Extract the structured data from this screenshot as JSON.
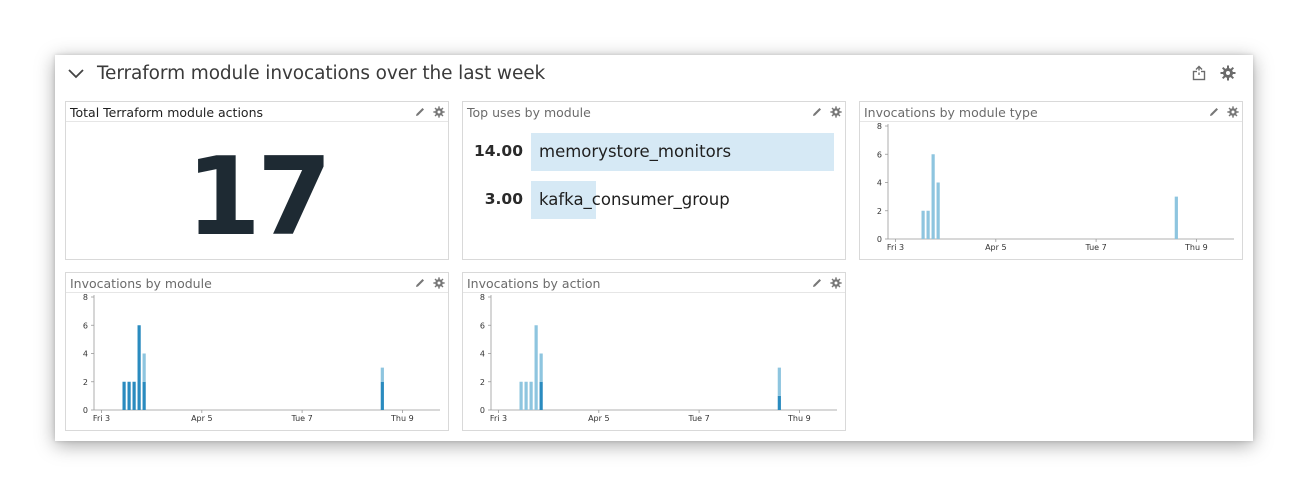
{
  "group": {
    "title": "Terraform module invocations over the last week",
    "icons": [
      "chevron-down-icon",
      "share-icon",
      "gear-icon"
    ]
  },
  "widgets": {
    "total": {
      "title": "Total Terraform module actions",
      "value": "17"
    },
    "toplist": {
      "title": "Top uses by module",
      "items": [
        {
          "value": "14.00",
          "label": "memorystore_monitors",
          "amount": 14
        },
        {
          "value": "3.00",
          "label": "kafka_consumer_group",
          "amount": 3
        }
      ]
    },
    "by_type": {
      "title": "Invocations by module type"
    },
    "by_module": {
      "title": "Invocations by module"
    },
    "by_action": {
      "title": "Invocations by action"
    }
  },
  "colors": {
    "light_bar": "#8ec5df",
    "dark_bar": "#2a8bbf",
    "toplist_bar": "#d6e9f5"
  },
  "chart_data": [
    {
      "id": "by_type",
      "type": "bar",
      "title": "Invocations by module type",
      "x_ticks": [
        "Fri 3",
        "Apr 5",
        "Tue 7",
        "Thu 9"
      ],
      "x_tick_days": [
        0,
        2,
        4,
        6
      ],
      "ylim": [
        0,
        8
      ],
      "y_ticks": [
        0,
        2,
        4,
        6,
        8
      ],
      "series": [
        {
          "color": "#8ec5df",
          "points": [
            [
              0.55,
              2
            ],
            [
              0.65,
              2
            ],
            [
              0.75,
              6
            ],
            [
              0.85,
              4
            ],
            [
              5.6,
              3
            ]
          ]
        }
      ]
    },
    {
      "id": "by_module",
      "type": "bar",
      "title": "Invocations by module",
      "x_ticks": [
        "Fri 3",
        "Apr 5",
        "Tue 7",
        "Thu 9"
      ],
      "x_tick_days": [
        0,
        2,
        4,
        6
      ],
      "ylim": [
        0,
        8
      ],
      "y_ticks": [
        0,
        2,
        4,
        6,
        8
      ],
      "series": [
        {
          "color": "#2a8bbf",
          "points": [
            [
              0.45,
              2
            ],
            [
              0.55,
              2
            ],
            [
              0.65,
              2
            ],
            [
              0.75,
              6
            ],
            [
              0.85,
              2
            ],
            [
              5.6,
              2
            ]
          ]
        },
        {
          "color": "#8ec5df",
          "points": [
            [
              0.45,
              0
            ],
            [
              0.55,
              0
            ],
            [
              0.65,
              0
            ],
            [
              0.75,
              0
            ],
            [
              0.85,
              2
            ],
            [
              5.6,
              1
            ]
          ]
        }
      ]
    },
    {
      "id": "by_action",
      "type": "bar",
      "title": "Invocations by action",
      "x_ticks": [
        "Fri 3",
        "Apr 5",
        "Tue 7",
        "Thu 9"
      ],
      "x_tick_days": [
        0,
        2,
        4,
        6
      ],
      "ylim": [
        0,
        8
      ],
      "y_ticks": [
        0,
        2,
        4,
        6,
        8
      ],
      "series": [
        {
          "color": "#2a8bbf",
          "points": [
            [
              0.45,
              0
            ],
            [
              0.55,
              0
            ],
            [
              0.65,
              0
            ],
            [
              0.75,
              0
            ],
            [
              0.85,
              2
            ],
            [
              5.6,
              1
            ]
          ]
        },
        {
          "color": "#8ec5df",
          "points": [
            [
              0.45,
              2
            ],
            [
              0.55,
              2
            ],
            [
              0.65,
              2
            ],
            [
              0.75,
              6
            ],
            [
              0.85,
              2
            ],
            [
              5.6,
              2
            ]
          ]
        }
      ]
    }
  ]
}
